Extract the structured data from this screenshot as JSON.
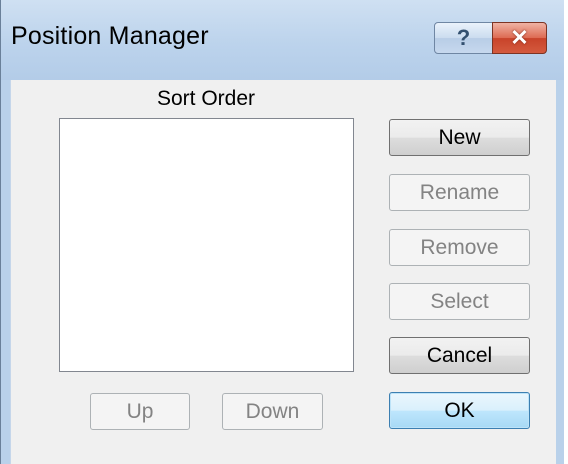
{
  "window": {
    "title": "Position Manager",
    "help_glyph": "?",
    "close_glyph": "✕"
  },
  "list": {
    "label": "Sort Order",
    "items": []
  },
  "buttons": {
    "new": "New",
    "rename": "Rename",
    "remove": "Remove",
    "select": "Select",
    "cancel": "Cancel",
    "ok": "OK",
    "up": "Up",
    "down": "Down"
  },
  "colors": {
    "titlebar": "#b9d1ea",
    "client_bg": "#f0f0f0",
    "close_red": "#c8432a",
    "default_button_border": "#3c7fb1",
    "disabled_text": "#838383"
  },
  "icons": {
    "help": "help-icon",
    "close": "close-icon"
  }
}
